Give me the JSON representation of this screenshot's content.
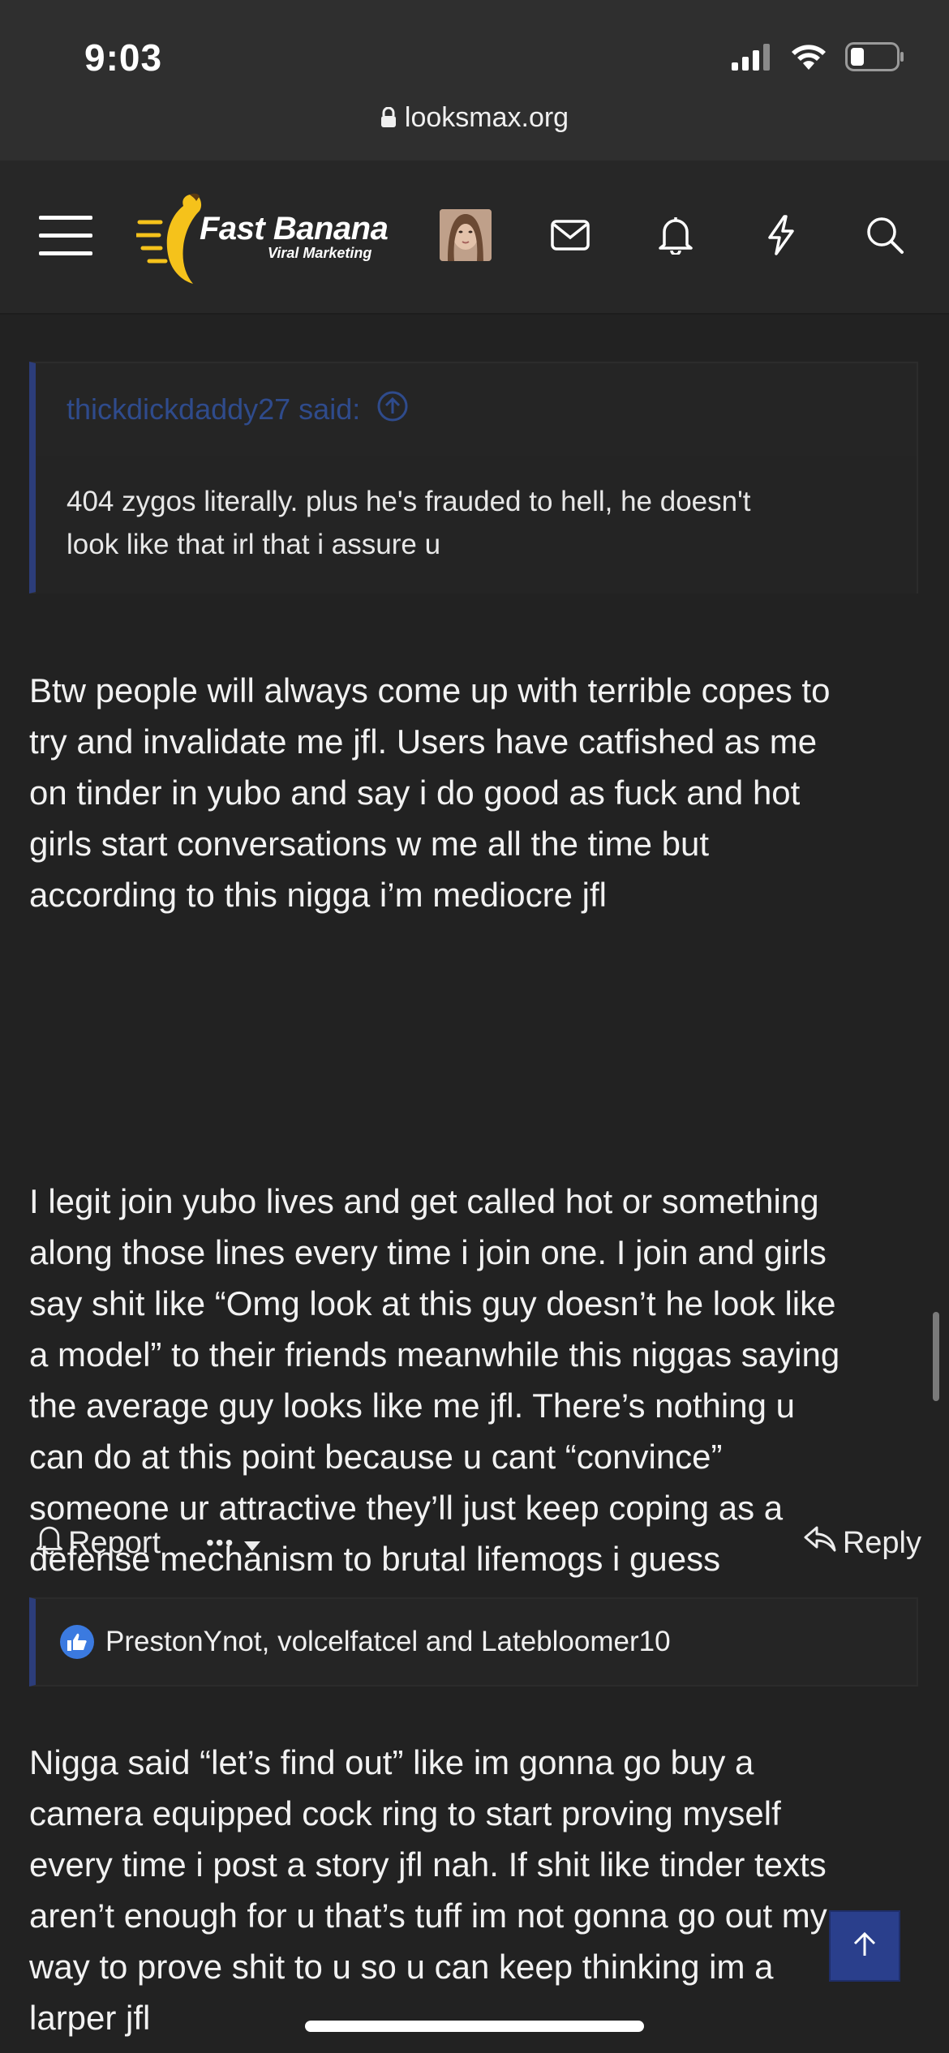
{
  "status_bar": {
    "time": "9:03"
  },
  "browser": {
    "url": "looksmax.org"
  },
  "header": {
    "logo_title": "Fast Banana",
    "logo_subtitle": "Viral Marketing",
    "icons": [
      "menu-icon",
      "avatar",
      "mail-icon",
      "bell-icon",
      "lightning-icon",
      "search-icon"
    ]
  },
  "post": {
    "quote": {
      "author_line": "thickdickdaddy27 said:",
      "text": "404 zygos literally. plus he's frauded to hell, he doesn't\nlook like that irl that i assure u"
    },
    "paragraphs": [
      "Btw people will always come up with terrible copes to\ntry and invalidate me jfl. Users have catfished as me\non tinder in yubo and say i do good as fuck and hot\ngirls start conversations w me all the time but\naccording to this nigga i’m mediocre jfl",
      "I legit join yubo lives and get called hot or something\nalong those lines every time i join one. I join and girls\nsay shit like “Omg look at this guy doesn’t he look like\na model” to their friends meanwhile this niggas saying\nthe average guy looks like me jfl. There’s nothing u\ncan do at this point because u cant “convince”\nsomeone ur attractive they’ll just keep coping as a\ndefense mechanism to brutal lifemogs i guess",
      "Nigga said “let’s find out” like im gonna go buy a\ncamera equipped cock ring to start proving myself\nevery time i post a story jfl nah. If shit like tinder texts\naren’t enough for u that’s tuff im not gonna go out my\nway to prove shit to u so u can keep thinking im a\nlarper jfl"
    ],
    "actions": {
      "report_label": "Report",
      "more_label": "•••",
      "reply_label": "Reply"
    },
    "reactions_text": "PrestonYnot, volcelfatcel and Latebloomer10"
  },
  "colors": {
    "background": "#222222",
    "accent": "#2c3d7a",
    "quote_author": "#2f4b8c",
    "like_blue": "#3b7ae0"
  }
}
